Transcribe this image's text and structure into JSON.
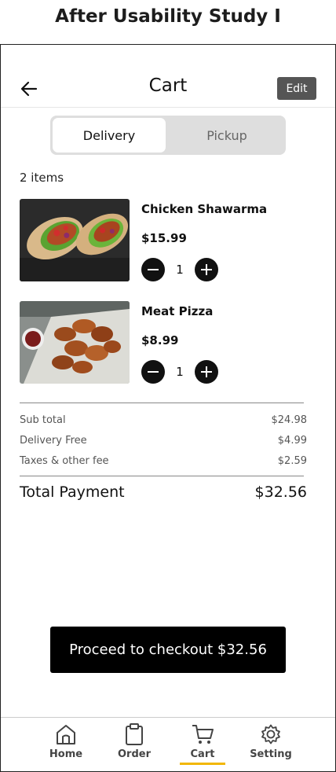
{
  "page_heading": "After Usability Study I",
  "header": {
    "title": "Cart",
    "edit_label": "Edit"
  },
  "tabs": [
    {
      "label": "Delivery",
      "active": true
    },
    {
      "label": "Pickup",
      "active": false
    }
  ],
  "cart": {
    "items_count": "2 items",
    "items": [
      {
        "name": "Chicken Shawarma",
        "price": "$15.99",
        "quantity": "1",
        "image": "shawarma-wrap-photo"
      },
      {
        "name": "Meat Pizza",
        "price": "$8.99",
        "quantity": "1",
        "image": "fried-chicken-wings-photo"
      }
    ]
  },
  "summary": {
    "rows": [
      {
        "label": "Sub total",
        "value": "$24.98"
      },
      {
        "label": "Delivery Free",
        "value": "$4.99"
      },
      {
        "label": "Taxes & other fee",
        "value": "$2.59"
      }
    ],
    "total_label": "Total Payment",
    "total_value": "$32.56"
  },
  "checkout_label": "Proceed to checkout $32.56",
  "nav": {
    "items": [
      {
        "label": "Home",
        "icon": "home-icon"
      },
      {
        "label": "Order",
        "icon": "clipboard-icon"
      },
      {
        "label": "Cart",
        "icon": "cart-icon",
        "active": true
      },
      {
        "label": "Setting",
        "icon": "gear-icon"
      }
    ],
    "active_color": "#f2b705"
  },
  "colors": {
    "button_dark": "#000000",
    "edit_button": "#555555",
    "segment_bg": "#dedede"
  }
}
